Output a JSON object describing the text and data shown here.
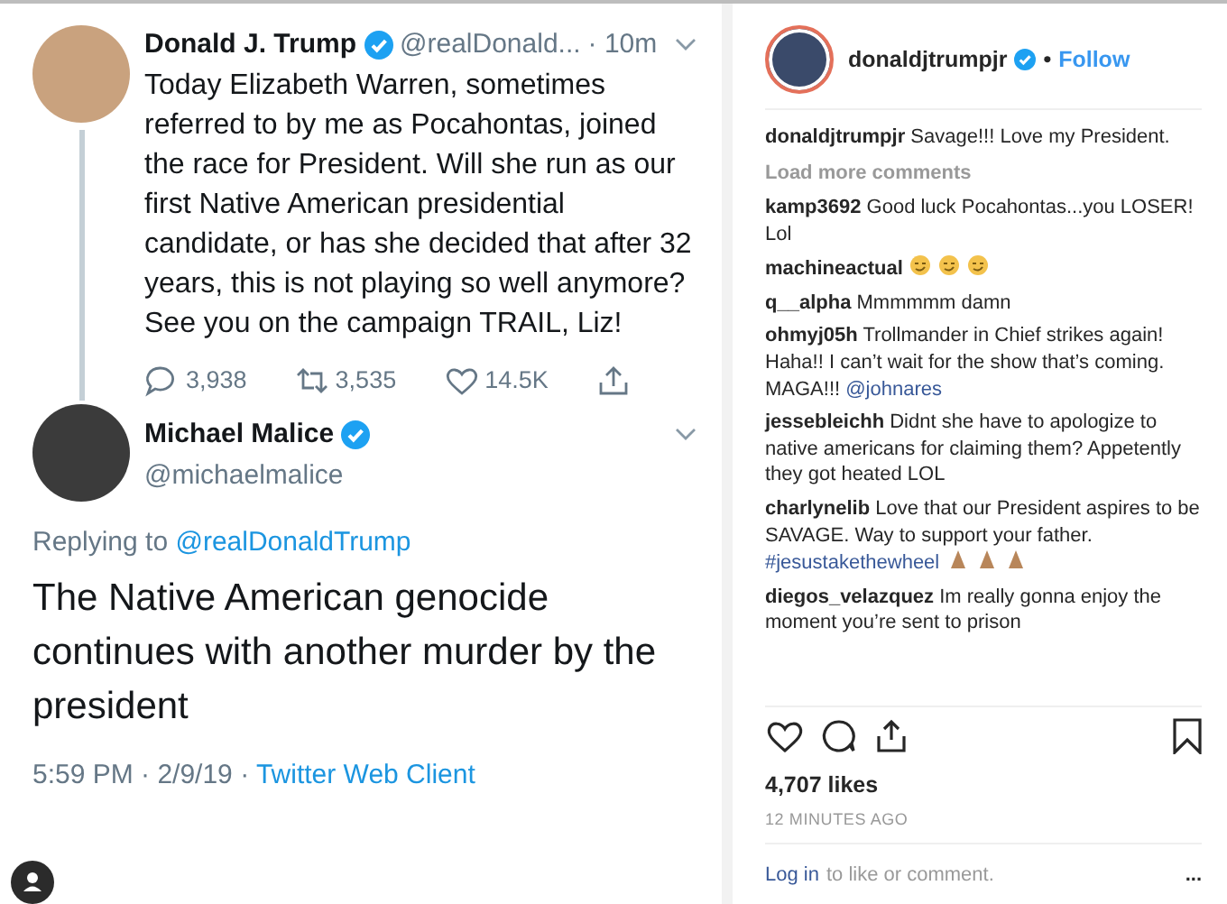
{
  "tweet": {
    "author": "Donald J. Trump",
    "verified": true,
    "handle": "@realDonald...",
    "time": "· 10m",
    "text": "Today Elizabeth Warren, sometimes referred to by me as Pocahontas, joined the race for President. Will she run as our first Native American presidential candidate, or has she decided that after 32 years, this is not playing so well anymore? See you on the campaign TRAIL, Liz!",
    "actions": [
      {
        "kind": "reply",
        "count": "3,938"
      },
      {
        "kind": "retweet",
        "count": "3,535"
      },
      {
        "kind": "like",
        "count": "14.5K"
      },
      {
        "kind": "share"
      }
    ]
  },
  "reply": {
    "author": "Michael Malice",
    "verified": true,
    "handle": "@michaelmalice",
    "replying_prefix": "Replying to",
    "replying_to": "@realDonaldTrump",
    "text": "The Native American genocide continues with another murder by the president",
    "timestamp": "5:59 PM · 2/9/19 ·",
    "source": "Twitter Web Client"
  },
  "instagram": {
    "username": "donaldjtrumpjr",
    "verified": true,
    "separator": "•",
    "follow": "Follow",
    "caption": {
      "user": "donaldjtrumpjr",
      "text": "Savage!!! Love my President."
    },
    "load_more": "Load more comments",
    "comments": [
      {
        "user": "kamp3692",
        "text": "Good luck Pocahontas...you LOSER! Lol"
      },
      {
        "user": "machineactual",
        "kind": "smiley_row"
      },
      {
        "user": "q__alpha",
        "text": "Mmmmmm damn"
      },
      {
        "user": "ohmyj05h",
        "text": "Trollmander in Chief strikes again! Haha!! I can’t wait for the show that’s coming. MAGA!!!",
        "link": "@johnares"
      },
      {
        "user": "jessebleichh",
        "text": "Didnt she have to apologize to native americans for claiming them? Appetently they got heated LOL"
      },
      {
        "user": "charlynelib",
        "text": "Love that our President aspires to be SAVAGE. Way to support your father.",
        "link": "#jesustakethewheel",
        "kind": "prayer_row"
      },
      {
        "user": "diegos_velazquez",
        "text": "Im really gonna enjoy the moment you’re sent to prison"
      }
    ],
    "likes": "4,707 likes",
    "time": "12 MINUTES AGO",
    "login_link": "Log in",
    "login_text": "to like or comment.",
    "more": "..."
  }
}
